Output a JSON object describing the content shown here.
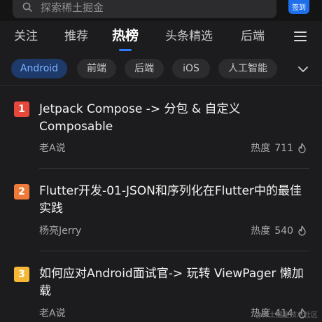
{
  "search": {
    "placeholder": "探索稀土掘金"
  },
  "header": {
    "signin_label": "签到"
  },
  "tabs": [
    {
      "label": "关注"
    },
    {
      "label": "推荐"
    },
    {
      "label": "热榜",
      "active": true
    },
    {
      "label": "头条精选"
    },
    {
      "label": "后端"
    }
  ],
  "chips": [
    {
      "label": "Android",
      "active": true
    },
    {
      "label": "前端"
    },
    {
      "label": "后端"
    },
    {
      "label": "iOS"
    },
    {
      "label": "人工智能"
    }
  ],
  "articles": [
    {
      "rank": "1",
      "title": "Jetpack Compose -> 分包 & 自定义Composable",
      "author": "老A说",
      "heat_label": "热度",
      "heat_value": "711"
    },
    {
      "rank": "2",
      "title": "Flutter开发-01-JSON和序列化在Flutter中的最佳实践",
      "author": "杨亮Jerry",
      "heat_label": "热度",
      "heat_value": "540"
    },
    {
      "rank": "3",
      "title": "如何应对Android面试官-> 玩转 ViewPager 懒加载",
      "author": "老A说",
      "heat_label": "热度",
      "heat_value": "414"
    }
  ],
  "watermark": "@稀土掘金技术社区",
  "colors": {
    "accent": "#2f7bff",
    "rank_1": "#e8483b",
    "rank_2": "#ee7a3a",
    "rank_3": "#f5b836"
  }
}
